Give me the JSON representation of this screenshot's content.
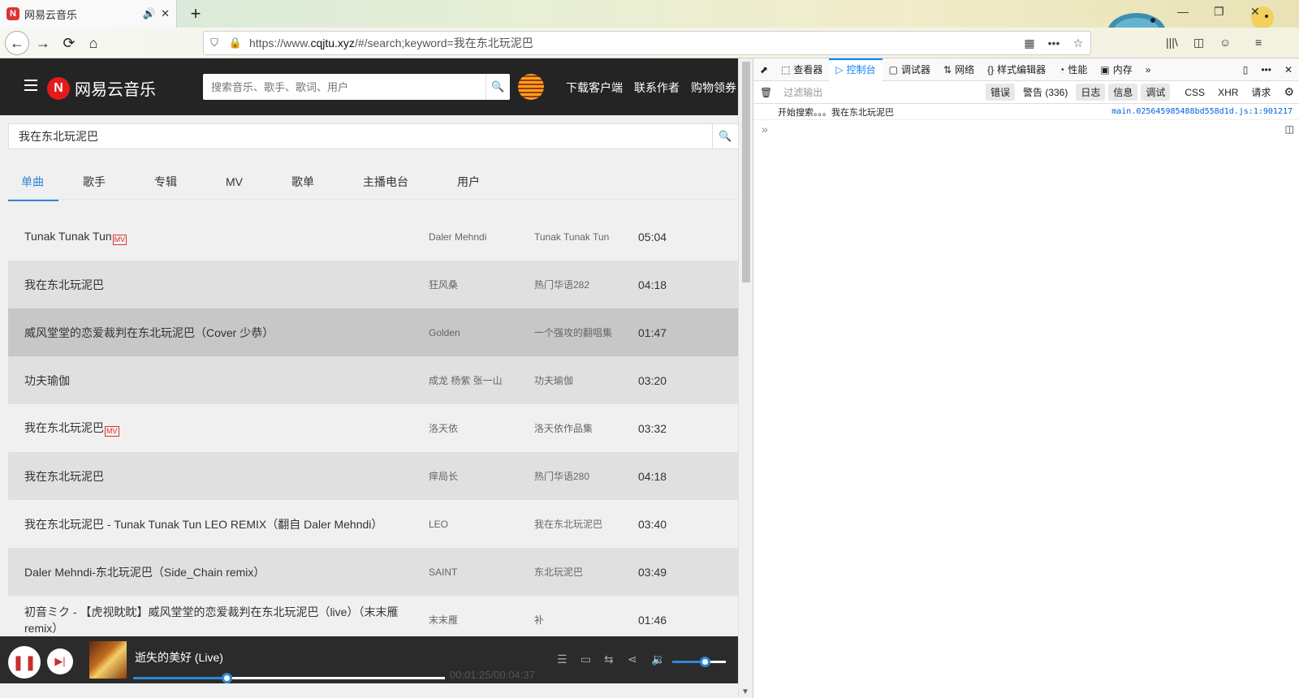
{
  "browser": {
    "tab_title": "网易云音乐",
    "tab_favicon": "N",
    "tab_audio_icon": "🔊",
    "tab_close": "✕",
    "new_tab": "+",
    "window_controls": [
      "—",
      "❐",
      "✕"
    ],
    "url_prefix": "https://www.",
    "url_domain": "cqjtu.xyz",
    "url_suffix": "/#/search;keyword=我在东北玩泥巴",
    "nav": {
      "back": "←",
      "forward": "→",
      "reload": "⟳",
      "home": "⌂"
    },
    "url_icons": {
      "shield": "⛉",
      "lock": "🔒",
      "qr": "▦",
      "more": "•••",
      "star": "☆"
    },
    "toolbar_icons": {
      "library": "|||\\",
      "sidebar": "◫",
      "account": "☺",
      "menu": "≡"
    }
  },
  "app": {
    "logo_mark": "N",
    "logo_text": "网易云音乐",
    "search_placeholder": "搜索音乐、歌手、歌词、用户",
    "search_icon": "🔍",
    "header_links": [
      "下载客户端",
      "联系作者",
      "购物领券"
    ],
    "page_search_value": "我在东北玩泥巴",
    "tabs": [
      "单曲",
      "歌手",
      "专辑",
      "MV",
      "歌单",
      "主播电台",
      "用户"
    ],
    "mv_tag": "MV",
    "songs": [
      {
        "name": "Tunak Tunak Tun",
        "mv": true,
        "artist": "Daler Mehndi",
        "album": "Tunak Tunak Tun",
        "duration": "05:04"
      },
      {
        "name": "我在东北玩泥巴",
        "mv": false,
        "artist": "狂风桑",
        "album": "热门华语282",
        "duration": "04:18"
      },
      {
        "name": "威风堂堂的恋爱裁判在东北玩泥巴（Cover 少恭）",
        "mv": false,
        "artist": "Golden",
        "album": "一个强攻的翻唱集",
        "duration": "01:47"
      },
      {
        "name": "功夫瑜伽",
        "mv": false,
        "artist": "成龙 杨紫 张一山",
        "album": "功夫瑜伽",
        "duration": "03:20"
      },
      {
        "name": "我在东北玩泥巴",
        "mv": true,
        "artist": "洛天依",
        "album": "洛天依作品集",
        "duration": "03:32"
      },
      {
        "name": "我在东北玩泥巴",
        "mv": false,
        "artist": "痒局长",
        "album": "热门华语280",
        "duration": "04:18"
      },
      {
        "name": "我在东北玩泥巴 - Tunak Tunak Tun LEO REMIX（翻自 Daler Mehndi）",
        "mv": false,
        "artist": "LEO",
        "album": "我在东北玩泥巴",
        "duration": "03:40"
      },
      {
        "name": "Daler Mehndi-东北玩泥巴（Side_Chain remix）",
        "mv": false,
        "artist": "SAINT",
        "album": "东北玩泥巴",
        "duration": "03:49"
      },
      {
        "name": "初音ミク - 【虎视眈眈】威风堂堂的恋爱裁判在东北玩泥巴（live）（末末雁remix）",
        "mv": false,
        "artist": "末末雁",
        "album": "补",
        "duration": "01:46"
      }
    ],
    "player": {
      "play_icon": "❚❚",
      "next_icon": "▶|",
      "title": "逝失的美好 (Live)",
      "time": "00:01:25/00:04:37",
      "progress": 0.3,
      "volume": 0.6,
      "icons": [
        "☰",
        "▭",
        "⇆",
        "⋖",
        "🔉"
      ]
    }
  },
  "devtools": {
    "tabs": [
      {
        "icon": "⬚",
        "label": "查看器"
      },
      {
        "icon": "▷",
        "label": "控制台"
      },
      {
        "icon": "▢",
        "label": "调试器"
      },
      {
        "icon": "⇅",
        "label": "网络"
      },
      {
        "icon": "{}",
        "label": "样式编辑器"
      },
      {
        "icon": "◔",
        "label": "性能"
      },
      {
        "icon": "▣",
        "label": "内存"
      }
    ],
    "tab_more": "»",
    "pick_icon": "⬈",
    "right_icons": [
      "▯",
      "•••",
      "✕"
    ],
    "filter_placeholder": "过滤输出",
    "trash_icon": "🗑",
    "filter_buttons": [
      "错误",
      "警告 (336)",
      "日志",
      "信息",
      "调试"
    ],
    "filter_plain": [
      "CSS",
      "XHR",
      "请求"
    ],
    "settings_icon": "⚙",
    "log_message": "开始搜索。。。我在东北玩泥巴",
    "log_source": "main.025645985488bd558d1d.js:1:901217",
    "prompt": "»",
    "sidebar_toggle": "◫"
  }
}
